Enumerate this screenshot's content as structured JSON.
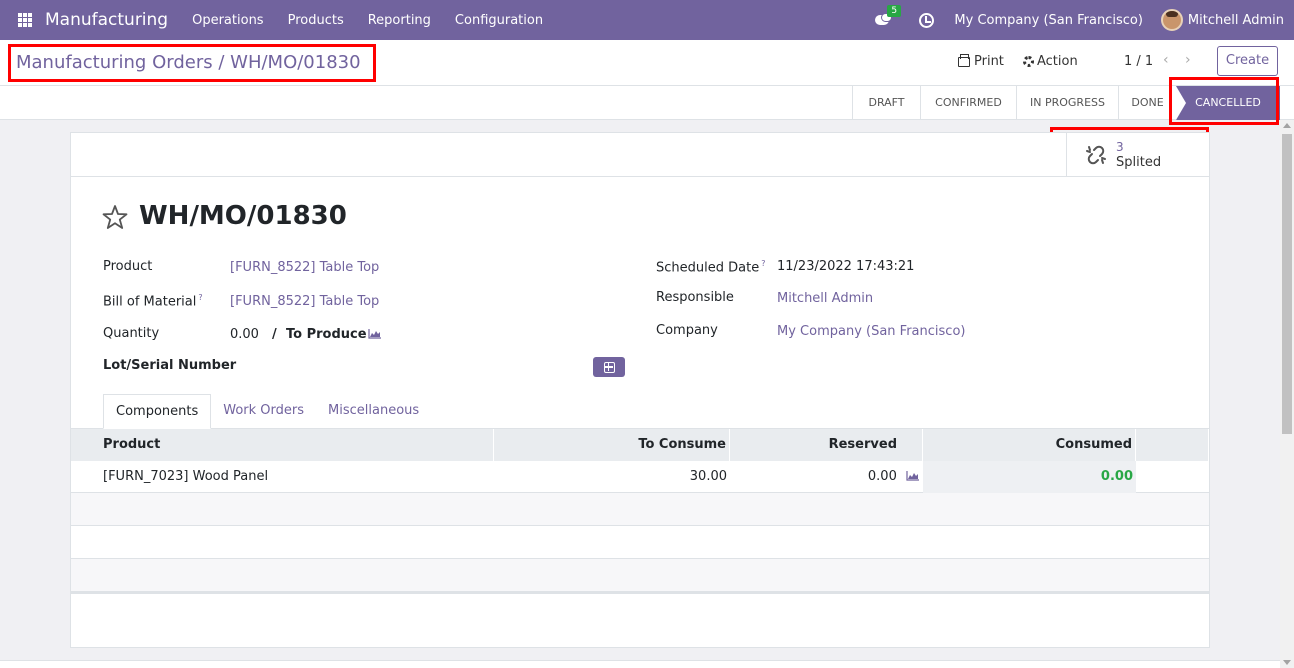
{
  "navbar": {
    "app_name": "Manufacturing",
    "menu": [
      "Operations",
      "Products",
      "Reporting",
      "Configuration"
    ],
    "messages_badge": "5",
    "company": "My Company (San Francisco)",
    "user": "Mitchell Admin"
  },
  "control_panel": {
    "breadcrumb_parent": "Manufacturing Orders",
    "breadcrumb_sep": "/",
    "breadcrumb_current": "WH/MO/01830",
    "print_label": "Print",
    "action_label": "Action",
    "pager": "1 / 1",
    "create_label": "Create"
  },
  "statusbar": {
    "stages": [
      "DRAFT",
      "CONFIRMED",
      "IN PROGRESS",
      "DONE",
      "CANCELLED"
    ],
    "current": "CANCELLED"
  },
  "smart_button": {
    "count": "3",
    "label": "Splited"
  },
  "form": {
    "title": "WH/MO/01830",
    "product_label": "Product",
    "product_value": "[FURN_8522] Table Top",
    "bom_label": "Bill of Material",
    "bom_help": "?",
    "bom_value": "[FURN_8522] Table Top",
    "quantity_label": "Quantity",
    "quantity_value": "0.00",
    "quantity_sep": "/",
    "to_produce_label": "To Produce",
    "lot_label": "Lot/Serial Number",
    "scheduled_label": "Scheduled Date",
    "scheduled_help": "?",
    "scheduled_value": "11/23/2022 17:43:21",
    "responsible_label": "Responsible",
    "responsible_value": "Mitchell Admin",
    "company_label": "Company",
    "company_value": "My Company (San Francisco)"
  },
  "tabs": [
    "Components",
    "Work Orders",
    "Miscellaneous"
  ],
  "table": {
    "headers": [
      "Product",
      "To Consume",
      "Reserved",
      "Consumed"
    ],
    "rows": [
      {
        "product": "[FURN_7023] Wood Panel",
        "to_consume": "30.00",
        "reserved": "0.00",
        "consumed": "0.00"
      }
    ]
  },
  "colors": {
    "brand": "#71639e",
    "highlight": "#ff0000",
    "success": "#28a745"
  }
}
